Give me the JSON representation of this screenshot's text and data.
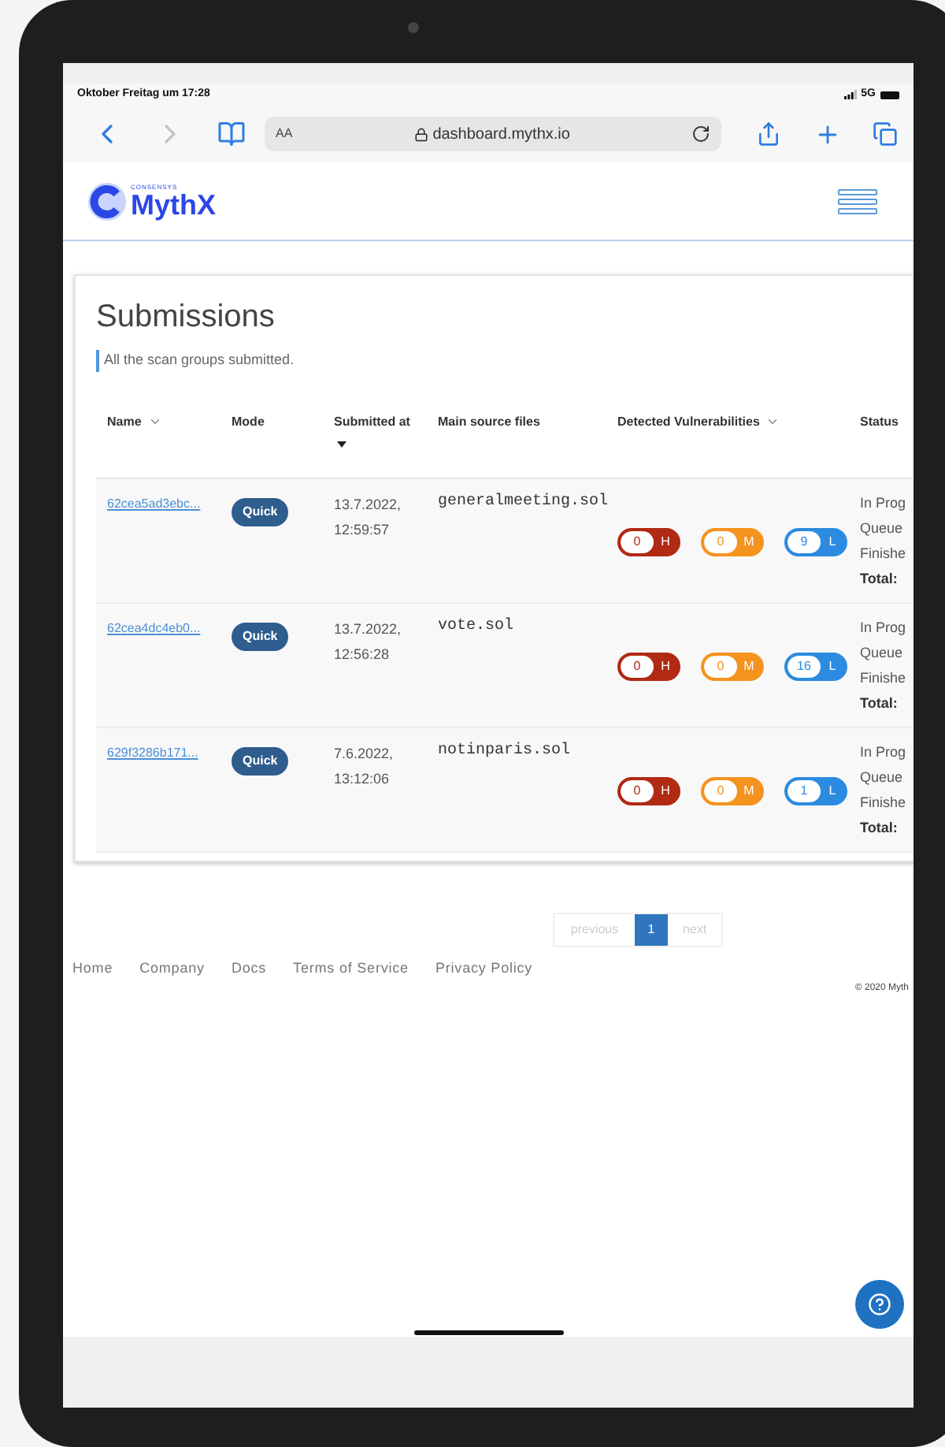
{
  "status_bar": {
    "time": "Oktober Freitag um 17:28",
    "network": "5G"
  },
  "browser": {
    "nav": [
      {
        "kind": "back",
        "disabled": false
      },
      {
        "kind": "forward",
        "disabled": true
      }
    ],
    "text_size": "AA",
    "url": "dashboard.mythx.io"
  },
  "site_header": {
    "brand_small": "CONSENSYS",
    "brand": "MythX"
  },
  "page": {
    "title": "Submissions",
    "subtitle": "All the scan groups submitted."
  },
  "table": {
    "columns": [
      {
        "label": "Name",
        "sortable": true,
        "sorted": false
      },
      {
        "label": "Mode",
        "sortable": false,
        "sorted": false
      },
      {
        "label": "Submitted at",
        "sortable": false,
        "sorted": true
      },
      {
        "label": "Main source files",
        "sortable": false,
        "sorted": false
      },
      {
        "label": "Detected Vulnerabilities",
        "sortable": true,
        "sorted": false
      },
      {
        "label": "Status",
        "sortable": false,
        "sorted": false
      }
    ],
    "rows": [
      {
        "name": "62cea5ad3ebc...",
        "mode": "Quick",
        "date": "13.7.2022,",
        "time": "12:59:57",
        "file": "generalmeeting.sol",
        "vulnerabilities": [
          {
            "count": "0",
            "label": "H",
            "color": "#b02a14"
          },
          {
            "count": "0",
            "label": "M",
            "color": "#f5931f"
          },
          {
            "count": "9",
            "label": "L",
            "color": "#2b8be0"
          }
        ],
        "status": [
          "In Prog",
          "Queue",
          "Finishe"
        ],
        "total": "Total:"
      },
      {
        "name": "62cea4dc4eb0...",
        "mode": "Quick",
        "date": "13.7.2022,",
        "time": "12:56:28",
        "file": "vote.sol",
        "vulnerabilities": [
          {
            "count": "0",
            "label": "H",
            "color": "#b02a14"
          },
          {
            "count": "0",
            "label": "M",
            "color": "#f5931f"
          },
          {
            "count": "16",
            "label": "L",
            "color": "#2b8be0"
          }
        ],
        "status": [
          "In Prog",
          "Queue",
          "Finishe"
        ],
        "total": "Total:"
      },
      {
        "name": "629f3286b171...",
        "mode": "Quick",
        "date": "7.6.2022,",
        "time": "13:12:06",
        "file": "notinparis.sol",
        "vulnerabilities": [
          {
            "count": "0",
            "label": "H",
            "color": "#b02a14"
          },
          {
            "count": "0",
            "label": "M",
            "color": "#f5931f"
          },
          {
            "count": "1",
            "label": "L",
            "color": "#2b8be0"
          }
        ],
        "status": [
          "In Prog",
          "Queue",
          "Finishe"
        ],
        "total": "Total:"
      }
    ]
  },
  "pagination": {
    "previous": "previous",
    "pages": [
      {
        "label": "1",
        "selected": true
      }
    ],
    "next": "next"
  },
  "footer": {
    "links": [
      "Home",
      "Company",
      "Docs",
      "Terms of Service",
      "Privacy Policy"
    ],
    "copyright": "© 2020 Myth"
  }
}
